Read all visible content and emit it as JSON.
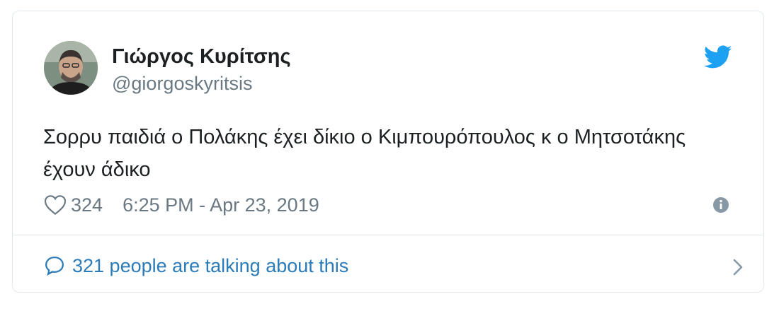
{
  "tweet": {
    "display_name": "Γιώργος Κυρίτσης",
    "handle": "@giorgoskyritsis",
    "text": "Σορρυ παιδιά ο Πολάκης έχει δίκιο ο Κιμπουρόπουλος κ ο Μητσοτάκης έχουν άδικο",
    "likes": "324",
    "timestamp": "6:25 PM - Apr 23, 2019"
  },
  "footer": {
    "talking_text": "321 people are talking about this"
  },
  "icons": {
    "brand": "twitter-bird-icon",
    "like": "heart-icon",
    "info": "info-icon",
    "conversation": "speech-bubble-icon",
    "next": "chevron-right-icon"
  },
  "colors": {
    "twitter_blue": "#1da1f2",
    "link_blue": "#2b7bb9",
    "secondary_text": "#697882",
    "primary_text": "#1c2022",
    "border": "#e1e8ed"
  }
}
